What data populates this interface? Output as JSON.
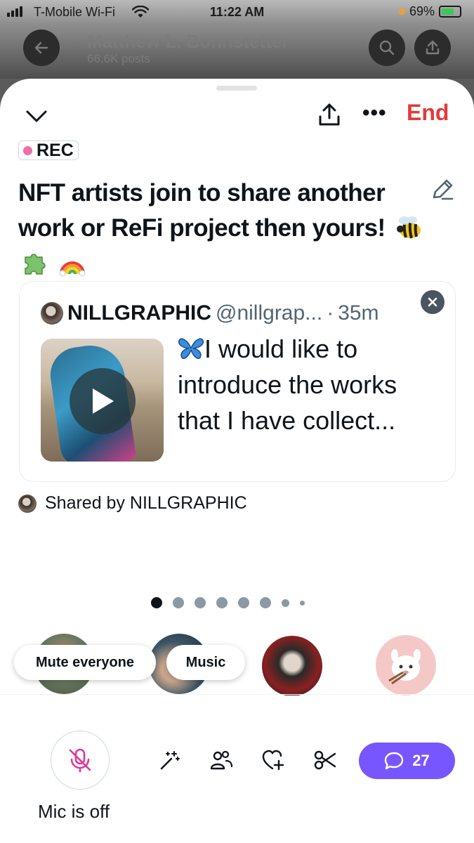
{
  "status_bar": {
    "carrier": "T-Mobile Wi-Fi",
    "time": "11:22 AM",
    "battery": "69%",
    "battery_level": 0.69
  },
  "background_header": {
    "name": "Matthew L. Bonnstetter",
    "posts": "66.6K posts"
  },
  "space": {
    "end_label": "End",
    "rec_label": "REC",
    "title": "NFT artists join to share another work or ReFi project then yours!",
    "title_emojis": [
      "bee-emoji",
      "puzzle-piece-emoji",
      "rainbow-emoji"
    ]
  },
  "pinned_post": {
    "author_name": "NILLGRAPHIC",
    "handle": "@nillgrap...",
    "separator": "·",
    "time": "35m",
    "text": "I would like to introduce the works that I have collect...",
    "shared_by": "Shared by NILLGRAPHIC"
  },
  "pager": {
    "total": 8,
    "active_index": 0
  },
  "speaker_actions": {
    "mute_everyone": "Mute everyone",
    "music": "Music"
  },
  "bottom_bar": {
    "mic_label": "Mic is off",
    "comment_count": "27"
  },
  "colors": {
    "end": "#e33a3a",
    "rec_dot": "#ef6ea8",
    "comment_button": "#7856ff",
    "mic_off_icon": "#e0389a"
  }
}
